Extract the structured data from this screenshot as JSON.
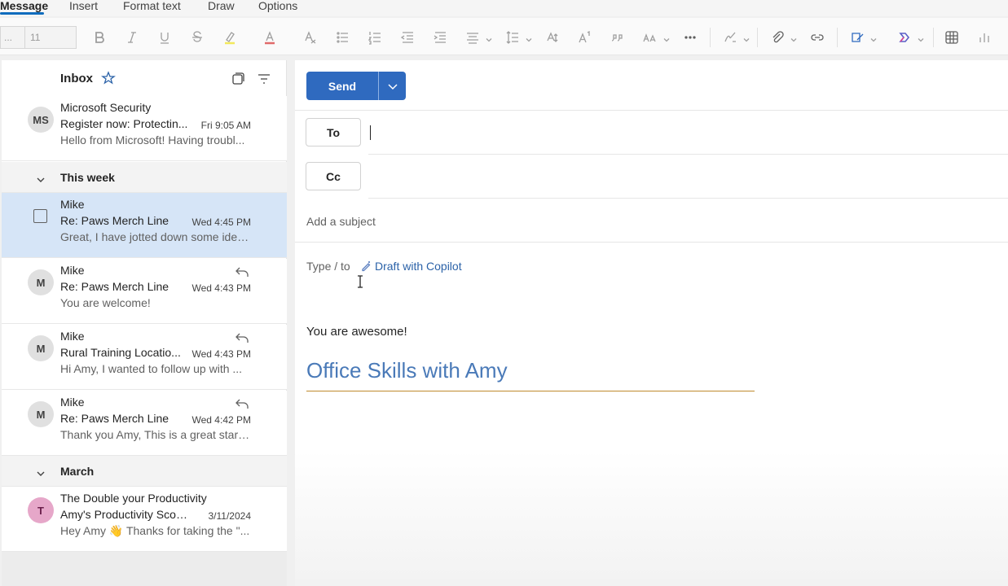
{
  "ribbon": {
    "tabs": [
      {
        "label": "Message",
        "active": true
      },
      {
        "label": "Insert",
        "active": false
      },
      {
        "label": "Format text",
        "active": false
      },
      {
        "label": "Draw",
        "active": false
      },
      {
        "label": "Options",
        "active": false
      }
    ],
    "font_name": "...",
    "font_size": "11",
    "accent_color": "#0f6cbd"
  },
  "mail_list": {
    "title": "Inbox",
    "messages_top": [
      {
        "initials": "MS",
        "sender": "Microsoft Security",
        "subject": "Register now: Protectin...",
        "time": "Fri 9:05 AM",
        "preview": "Hello from Microsoft! Having troubl..."
      }
    ],
    "groups": [
      {
        "label": "This week",
        "messages": [
          {
            "initials": "",
            "sender": "Mike",
            "subject": "Re: Paws Merch Line",
            "time": "Wed 4:45 PM",
            "preview": "Great, I have jotted down some idea...",
            "selected": true
          },
          {
            "initials": "M",
            "sender": "Mike",
            "subject": "Re: Paws Merch Line",
            "time": "Wed 4:43 PM",
            "preview": "You are welcome!",
            "replied": true
          },
          {
            "initials": "M",
            "sender": "Mike",
            "subject": "Rural Training Locatio...",
            "time": "Wed 4:43 PM",
            "preview": "Hi Amy, I wanted to follow up with ...",
            "replied": true
          },
          {
            "initials": "M",
            "sender": "Mike",
            "subject": "Re: Paws Merch Line",
            "time": "Wed 4:42 PM",
            "preview": "Thank you Amy, This is a great starti...",
            "replied": true
          }
        ]
      },
      {
        "label": "March",
        "messages": [
          {
            "initials": "T",
            "sender": "The Double your Productivity",
            "subject": "Amy's Productivity Score...",
            "time": "3/11/2024",
            "preview": "Hey Amy 👋 Thanks for taking the \"..."
          }
        ]
      }
    ]
  },
  "compose": {
    "send_label": "Send",
    "to_label": "To",
    "cc_label": "Cc",
    "to_value": "",
    "subject_placeholder": "Add a subject",
    "body_hint": "Type / to",
    "copilot_label": "Draft with Copilot",
    "body_text": "You are awesome!",
    "signature": "Office Skills with Amy",
    "send_color": "#2f6abf",
    "signature_color": "#4a7ab8"
  }
}
